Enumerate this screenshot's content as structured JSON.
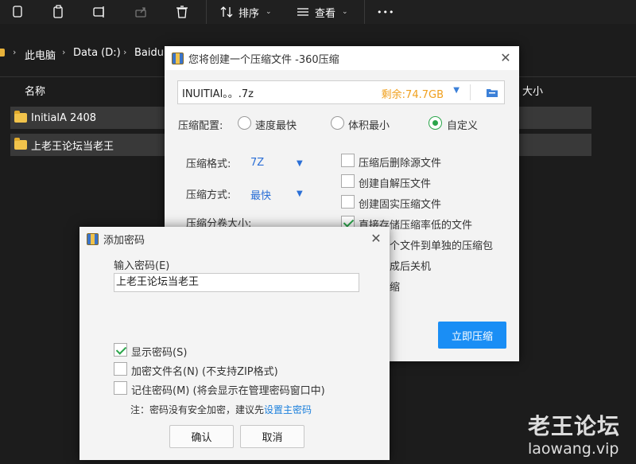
{
  "explorer": {
    "toolbar": {
      "sort_label": "排序",
      "view_label": "查看",
      "more_label": "•••"
    },
    "breadcrumb": [
      "此电脑",
      "Data (D:)",
      "Baidu"
    ],
    "columns": {
      "name": "名称",
      "size": "大小"
    },
    "files": [
      {
        "name": "InitialA 2408"
      },
      {
        "name": "上老王论坛当老王"
      }
    ],
    "colors": {
      "background": "#1c1c1c",
      "row": "#393939",
      "folder": "#f1c34b"
    }
  },
  "compress_dialog": {
    "title": "您将创建一个压缩文件 -360压缩",
    "path": "INUITIAl。。.7z",
    "free_space": "剩余:74.7GB",
    "config_label": "压缩配置:",
    "options": [
      "速度最快",
      "体积最小",
      "自定义"
    ],
    "selected_option": "自定义",
    "format_label": "压缩格式:",
    "format_value": "7Z",
    "method_label": "压缩方式:",
    "method_value": "最快",
    "split_label": "压缩分卷大小:",
    "checkboxes": [
      {
        "label": "压缩后删除源文件",
        "checked": false
      },
      {
        "label": "创建自解压文件",
        "checked": false
      },
      {
        "label": "创建固实压缩文件",
        "checked": false
      },
      {
        "label": "直接存储压缩率低的文件",
        "checked": true
      },
      {
        "label": "个文件到单独的压缩包",
        "checked": false
      },
      {
        "label": "成后关机",
        "checked": false
      },
      {
        "label": "缩",
        "checked": false
      }
    ],
    "submit_label": "立即压缩",
    "colors": {
      "accent": "#1a8ef5",
      "free_space": "#f0a01e",
      "check": "#2aa54a"
    }
  },
  "password_dialog": {
    "title": "添加密码",
    "input_label": "输入密码(E)",
    "password_value": "上老王论坛当老王",
    "checkboxes": [
      {
        "label": "显示密码(S)",
        "checked": true
      },
      {
        "label": "加密文件名(N) (不支持ZIP格式)",
        "checked": false
      },
      {
        "label": "记住密码(M) (将会显示在管理密码窗口中)",
        "checked": false
      }
    ],
    "note": "注：密码没有安全加密，建议先",
    "note_link": "设置主密码",
    "ok_label": "确认",
    "cancel_label": "取消"
  },
  "watermark": {
    "title": "老王论坛",
    "url": "laowang.vip"
  }
}
